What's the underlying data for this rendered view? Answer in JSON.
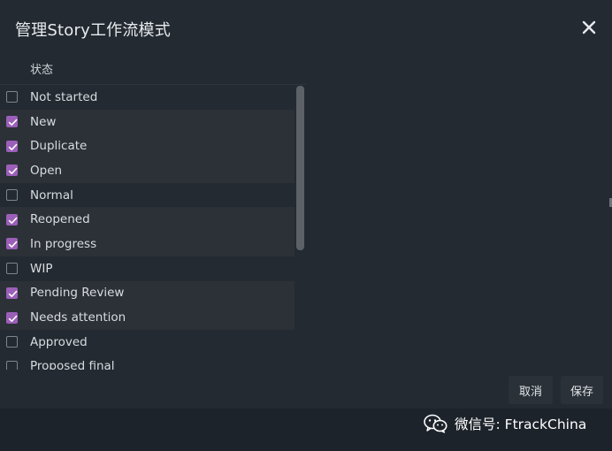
{
  "dialog": {
    "title": "管理Story工作流模式",
    "close_icon": "close-icon",
    "column_header": "状态"
  },
  "statuses": [
    {
      "label": "Not started",
      "checked": false
    },
    {
      "label": "New",
      "checked": true
    },
    {
      "label": "Duplicate",
      "checked": true
    },
    {
      "label": "Open",
      "checked": true
    },
    {
      "label": "Normal",
      "checked": false
    },
    {
      "label": "Reopened",
      "checked": true
    },
    {
      "label": "In progress",
      "checked": true
    },
    {
      "label": "WIP",
      "checked": false
    },
    {
      "label": "Pending Review",
      "checked": true
    },
    {
      "label": "Needs attention",
      "checked": true
    },
    {
      "label": "Approved",
      "checked": false
    },
    {
      "label": "Proposed final",
      "checked": false
    }
  ],
  "footer": {
    "cancel_label": "取消",
    "save_label": "保存"
  },
  "watermark": {
    "icon": "wechat-icon",
    "text": "微信号: FtrackChina"
  },
  "colors": {
    "accent": "#9b5fb8",
    "dialog_bg": "#232a31",
    "row_highlight": "#2b3137"
  }
}
